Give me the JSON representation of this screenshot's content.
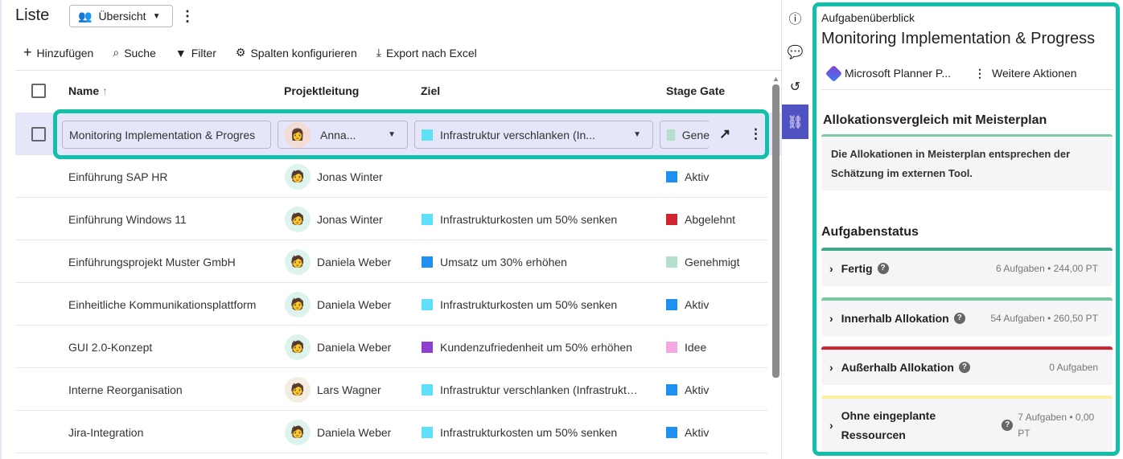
{
  "list": {
    "title": "Liste",
    "view": "Übersicht",
    "toolbar": {
      "add": "Hinzufügen",
      "search": "Suche",
      "filter": "Filter",
      "columns": "Spalten konfigurieren",
      "export": "Export nach Excel"
    },
    "columns": {
      "name": "Name",
      "lead": "Projektleitung",
      "goal": "Ziel",
      "stage": "Stage Gate"
    },
    "selected": {
      "name": "Monitoring Implementation & Progres",
      "lead": "Anna...",
      "goal": "Infrastruktur verschlanken (In...",
      "goal_color": "#5ee0f8",
      "stage": "Gene",
      "stage_color": "#b2e0cc"
    },
    "rows": [
      {
        "name": "Einführung SAP HR",
        "lead": "Jonas Winter",
        "goal": "",
        "goal_color": "",
        "stage": "Aktiv",
        "stage_color": "#1e90f0"
      },
      {
        "name": "Einführung Windows 11",
        "lead": "Jonas Winter",
        "goal": "Infrastrukturkosten um 50% senken",
        "goal_color": "#5ee0f8",
        "stage": "Abgelehnt",
        "stage_color": "#d0242f"
      },
      {
        "name": "Einführungsprojekt Muster GmbH",
        "lead": "Daniela Weber",
        "goal": "Umsatz um 30% erhöhen",
        "goal_color": "#1e90f0",
        "stage": "Genehmigt",
        "stage_color": "#b2e0cc"
      },
      {
        "name": "Einheitliche Kommunikationsplattform",
        "lead": "Daniela Weber",
        "goal": "Infrastrukturkosten um 50% senken",
        "goal_color": "#5ee0f8",
        "stage": "Aktiv",
        "stage_color": "#1e90f0"
      },
      {
        "name": "GUI 2.0-Konzept",
        "lead": "Daniela Weber",
        "goal": "Kundenzufriedenheit um 50% erhöhen",
        "goal_color": "#8e3fd0",
        "stage": "Idee",
        "stage_color": "#f2a8e0"
      },
      {
        "name": "Interne Reorganisation",
        "lead": "Lars Wagner",
        "goal": "Infrastruktur verschlanken (Infrastrukt…",
        "goal_color": "#5ee0f8",
        "stage": "Aktiv",
        "stage_color": "#1e90f0"
      },
      {
        "name": "Jira-Integration",
        "lead": "Daniela Weber",
        "goal": "Infrastrukturkosten um 50% senken",
        "goal_color": "#5ee0f8",
        "stage": "Aktiv",
        "stage_color": "#1e90f0"
      }
    ]
  },
  "panel": {
    "subtitle": "Aufgabenüberblick",
    "title": "Monitoring Implementation & Progress",
    "integration": "Microsoft Planner P...",
    "more": "Weitere Aktionen",
    "alloc_heading": "Allokationsvergleich mit Meisterplan",
    "alloc_text": "Die Allokationen in Meisterplan entsprechen der Schätzung im externen Tool.",
    "status_heading": "Aufgabenstatus",
    "statuses": [
      {
        "label": "Fertig",
        "meta": "6 Aufgaben • 244,00 PT",
        "color": "#3fa98a"
      },
      {
        "label": "Innerhalb Allokation",
        "meta": "54 Aufgaben • 260,50 PT",
        "color": "#7cc7a4"
      },
      {
        "label": "Außerhalb Allokation",
        "meta": "0 Aufgaben",
        "color": "#d0242f"
      },
      {
        "label": "Ohne eingeplante Ressourcen",
        "meta": "7 Aufgaben • 0,00 PT",
        "color": "#fdeea0"
      }
    ]
  },
  "accent": "#14bfa9",
  "rail_active": "#5052c4"
}
